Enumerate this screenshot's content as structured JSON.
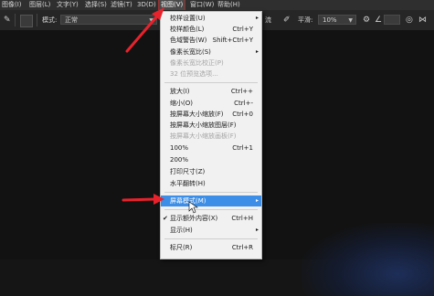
{
  "menubar": {
    "items": [
      {
        "label": "图像(I)"
      },
      {
        "label": "图层(L)"
      },
      {
        "label": "文字(Y)"
      },
      {
        "label": "选择(S)"
      },
      {
        "label": "滤镜(T)"
      },
      {
        "label": "3D(D)"
      },
      {
        "label": "视图(V)"
      },
      {
        "label": "窗口(W)"
      },
      {
        "label": "帮助(H)"
      }
    ]
  },
  "options": {
    "mode_label": "模式:",
    "mode_value": "正常",
    "flow_label": "流",
    "smooth_label": "平滑:",
    "smooth_value": "10%"
  },
  "view_menu": {
    "items": [
      {
        "label": "校样设置(U)",
        "shortcut": "",
        "submenu": true,
        "disabled": false
      },
      {
        "label": "校样颜色(L)",
        "shortcut": "Ctrl+Y",
        "submenu": false,
        "disabled": false
      },
      {
        "label": "色域警告(W)",
        "shortcut": "Shift+Ctrl+Y",
        "submenu": false,
        "disabled": false
      },
      {
        "label": "像素长宽比(S)",
        "shortcut": "",
        "submenu": true,
        "disabled": false
      },
      {
        "label": "像素长宽比校正(P)",
        "shortcut": "",
        "submenu": false,
        "disabled": true
      },
      {
        "label": "32 位预览选项...",
        "shortcut": "",
        "submenu": false,
        "disabled": true
      },
      {
        "label": "放大(I)",
        "shortcut": "Ctrl++",
        "submenu": false,
        "disabled": false
      },
      {
        "label": "缩小(O)",
        "shortcut": "Ctrl+-",
        "submenu": false,
        "disabled": false
      },
      {
        "label": "按屏幕大小缩放(F)",
        "shortcut": "Ctrl+0",
        "submenu": false,
        "disabled": false
      },
      {
        "label": "按屏幕大小缩放图层(F)",
        "shortcut": "",
        "submenu": false,
        "disabled": false
      },
      {
        "label": "按屏幕大小缩放画板(F)",
        "shortcut": "",
        "submenu": false,
        "disabled": true
      },
      {
        "label": "100%",
        "shortcut": "Ctrl+1",
        "submenu": false,
        "disabled": false
      },
      {
        "label": "200%",
        "shortcut": "",
        "submenu": false,
        "disabled": false
      },
      {
        "label": "打印尺寸(Z)",
        "shortcut": "",
        "submenu": false,
        "disabled": false
      },
      {
        "label": "水平翻转(H)",
        "shortcut": "",
        "submenu": false,
        "disabled": false
      },
      {
        "label": "屏幕模式(M)",
        "shortcut": "",
        "submenu": true,
        "disabled": false,
        "highlighted": true
      },
      {
        "label": "显示额外内容(X)",
        "shortcut": "Ctrl+H",
        "submenu": false,
        "disabled": false,
        "checked": true
      },
      {
        "label": "显示(H)",
        "shortcut": "",
        "submenu": true,
        "disabled": false
      },
      {
        "label": "标尺(R)",
        "shortcut": "Ctrl+R",
        "submenu": false,
        "disabled": false
      }
    ],
    "submenu_glyph": "▸",
    "check_glyph": "✔"
  },
  "colors": {
    "highlight": "#3c8ee6",
    "annotation_arrow": "#e8222c",
    "menu_bg": "#f1f1f1"
  }
}
